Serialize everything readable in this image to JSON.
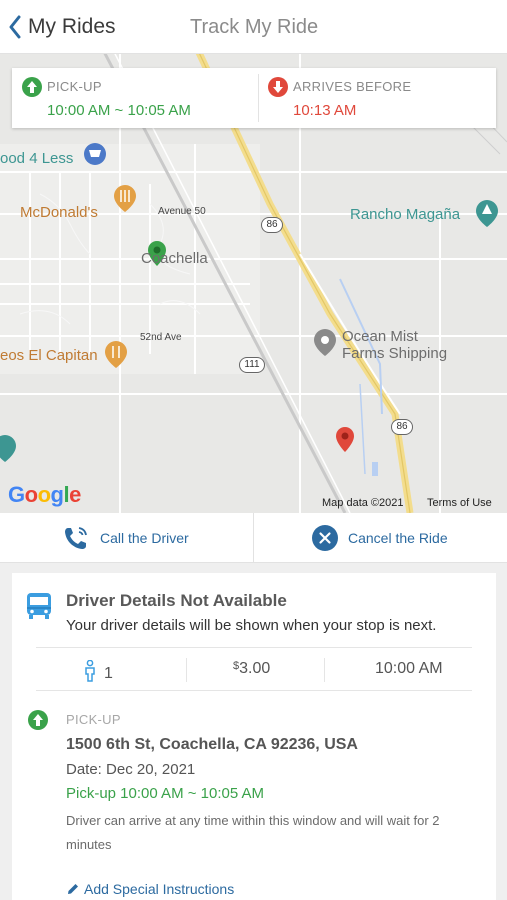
{
  "header": {
    "back_label": "My Rides",
    "title": "Track My Ride"
  },
  "trip_info": {
    "pickup_label": "PICK-UP",
    "pickup_window": "10:00 AM ~ 10:05 AM",
    "arrives_label": "ARRIVES BEFORE",
    "arrives_time": "10:13 AM"
  },
  "map": {
    "places": {
      "food4less": "ood 4 Less",
      "mcdonalds": "McDonald's",
      "avenue50": "Avenue 50",
      "coachella": "Coachella",
      "rancho": "Rancho Magaña",
      "ave52": "52nd Ave",
      "ocean_mist_1": "Ocean Mist",
      "ocean_mist_2": "Farms Shipping",
      "el_capitan": "eos El Capitan"
    },
    "shields": {
      "hwy86_top": "86",
      "hwy111": "111",
      "hwy86_bottom": "86"
    },
    "logo": "Google",
    "map_data": "Map data ©2021",
    "terms": "Terms of Use"
  },
  "actions": {
    "call_driver": "Call the Driver",
    "cancel_ride": "Cancel the Ride"
  },
  "driver": {
    "title": "Driver Details Not Available",
    "subtitle": "Your driver details will be shown when your stop is next."
  },
  "stats": {
    "passengers": "1",
    "fare_currency": "$",
    "fare_amount": "3.00",
    "time": "10:00 AM"
  },
  "pickup": {
    "label": "PICK-UP",
    "address": "1500 6th St, Coachella, CA 92236, USA",
    "date": "Date: Dec 20, 2021",
    "window": "Pick-up 10:00 AM ~ 10:05 AM",
    "note": "Driver can arrive at any time within this window and will wait for 2 minutes",
    "add_instructions": "Add Special Instructions"
  },
  "colors": {
    "accent_blue": "#2c6aa0",
    "pickup_green": "#3aa24a",
    "arrive_red": "#e0483b"
  }
}
